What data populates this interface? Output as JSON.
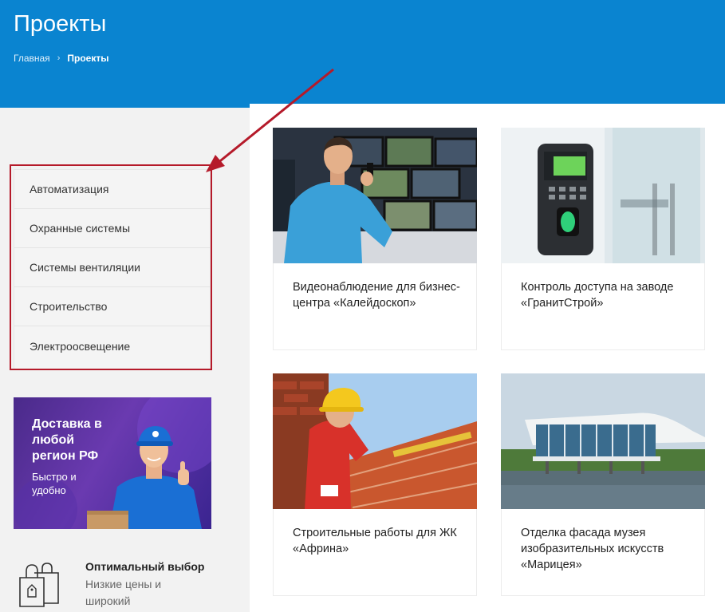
{
  "header": {
    "title": "Проекты",
    "breadcrumb": {
      "home": "Главная",
      "separator": "›",
      "current": "Проекты"
    }
  },
  "sidebar": {
    "items": [
      {
        "label": "Автоматизация"
      },
      {
        "label": "Охранные системы"
      },
      {
        "label": "Системы вентиляции"
      },
      {
        "label": "Строительство"
      },
      {
        "label": "Электроосвещение"
      }
    ]
  },
  "banner": {
    "title": "Доставка в любой регион РФ",
    "subtitle": "Быстро и удобно"
  },
  "promo": {
    "icon": "shopping-bag-icon",
    "title": "Оптимальный выбор",
    "text": "Низкие цены и широкий"
  },
  "projects": [
    {
      "title": "Видеонаблюдение для бизнес-центра «Калейдоскоп»"
    },
    {
      "title": "Контроль доступа на заводе «ГранитСтрой»"
    },
    {
      "title": "Строительные работы для ЖК «Африна»"
    },
    {
      "title": "Отделка фасада музея изобразительных искусств «Марицея»"
    }
  ],
  "colors": {
    "header_bg": "#0a84d0",
    "highlight": "#b51a2a",
    "page_bg": "#f2f2f2"
  }
}
